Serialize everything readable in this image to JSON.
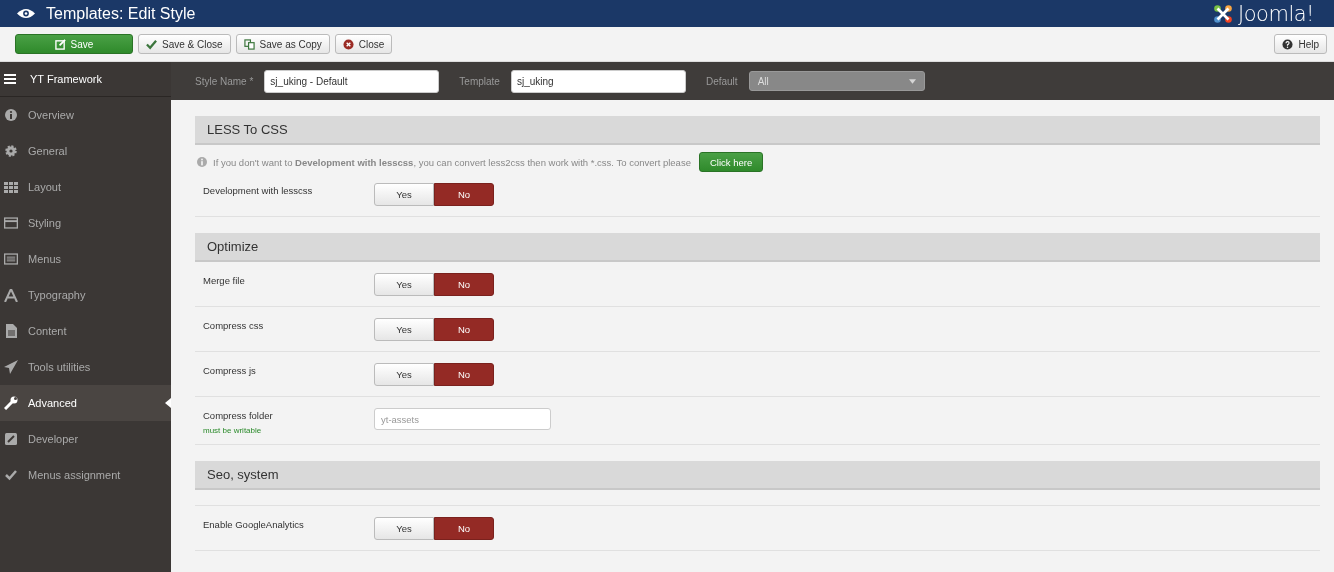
{
  "header": {
    "title": "Templates: Edit Style",
    "logo_text": "Joomla!"
  },
  "toolbar": {
    "buttons": [
      {
        "label": "Save",
        "kind": "primary"
      },
      {
        "label": "Save & Close",
        "kind": "check"
      },
      {
        "label": "Save as Copy",
        "kind": "copy"
      },
      {
        "label": "Close",
        "kind": "close"
      }
    ],
    "help": "Help"
  },
  "sidebar": {
    "title": "YT Framework",
    "items": [
      {
        "label": "Overview",
        "selected": false
      },
      {
        "label": "General",
        "selected": false
      },
      {
        "label": "Layout",
        "selected": false
      },
      {
        "label": "Styling",
        "selected": false
      },
      {
        "label": "Menus",
        "selected": false
      },
      {
        "label": "Typography",
        "selected": false
      },
      {
        "label": "Content",
        "selected": false
      },
      {
        "label": "Tools utilities",
        "selected": false
      },
      {
        "label": "Advanced",
        "selected": true
      },
      {
        "label": "Developer",
        "selected": false
      },
      {
        "label": "Menus assignment",
        "selected": false
      }
    ]
  },
  "style_bar": {
    "style_name": {
      "label": "Style Name *",
      "value": "sj_uking - Default"
    },
    "template": {
      "label": "Template",
      "value": "sj_uking"
    },
    "default": {
      "label": "Default",
      "value": "All",
      "disabled": true
    }
  },
  "sections": [
    {
      "title": "LESS To CSS",
      "note": "If you don't want to **Development with lesscss**, you can convert less2css then work with *.css. To convert please",
      "note_button": "Click here",
      "rows": [
        {
          "kind": "toggle",
          "label": "Development with lesscss",
          "options": [
            {
              "label": "Yes",
              "selected": false
            },
            {
              "label": "No",
              "selected": true
            }
          ]
        }
      ]
    },
    {
      "title": "Optimize",
      "rows": [
        {
          "kind": "toggle",
          "label": "Merge file",
          "options": [
            {
              "label": "Yes",
              "selected": false
            },
            {
              "label": "No",
              "selected": true
            }
          ]
        },
        {
          "kind": "toggle",
          "label": "Compress css",
          "options": [
            {
              "label": "Yes",
              "selected": false
            },
            {
              "label": "No",
              "selected": true
            }
          ]
        },
        {
          "kind": "toggle",
          "label": "Compress js",
          "options": [
            {
              "label": "Yes",
              "selected": false
            },
            {
              "label": "No",
              "selected": true
            }
          ]
        },
        {
          "kind": "text",
          "label": "Compress folder",
          "hint": "must be writable",
          "placeholder": "yt-assets"
        }
      ]
    },
    {
      "title": "Seo, system",
      "rows": [
        {
          "kind": "toggle",
          "label": "Enable GoogleAnalytics",
          "options": [
            {
              "label": "Yes",
              "selected": false
            },
            {
              "label": "No",
              "selected": true
            }
          ]
        }
      ]
    }
  ]
}
